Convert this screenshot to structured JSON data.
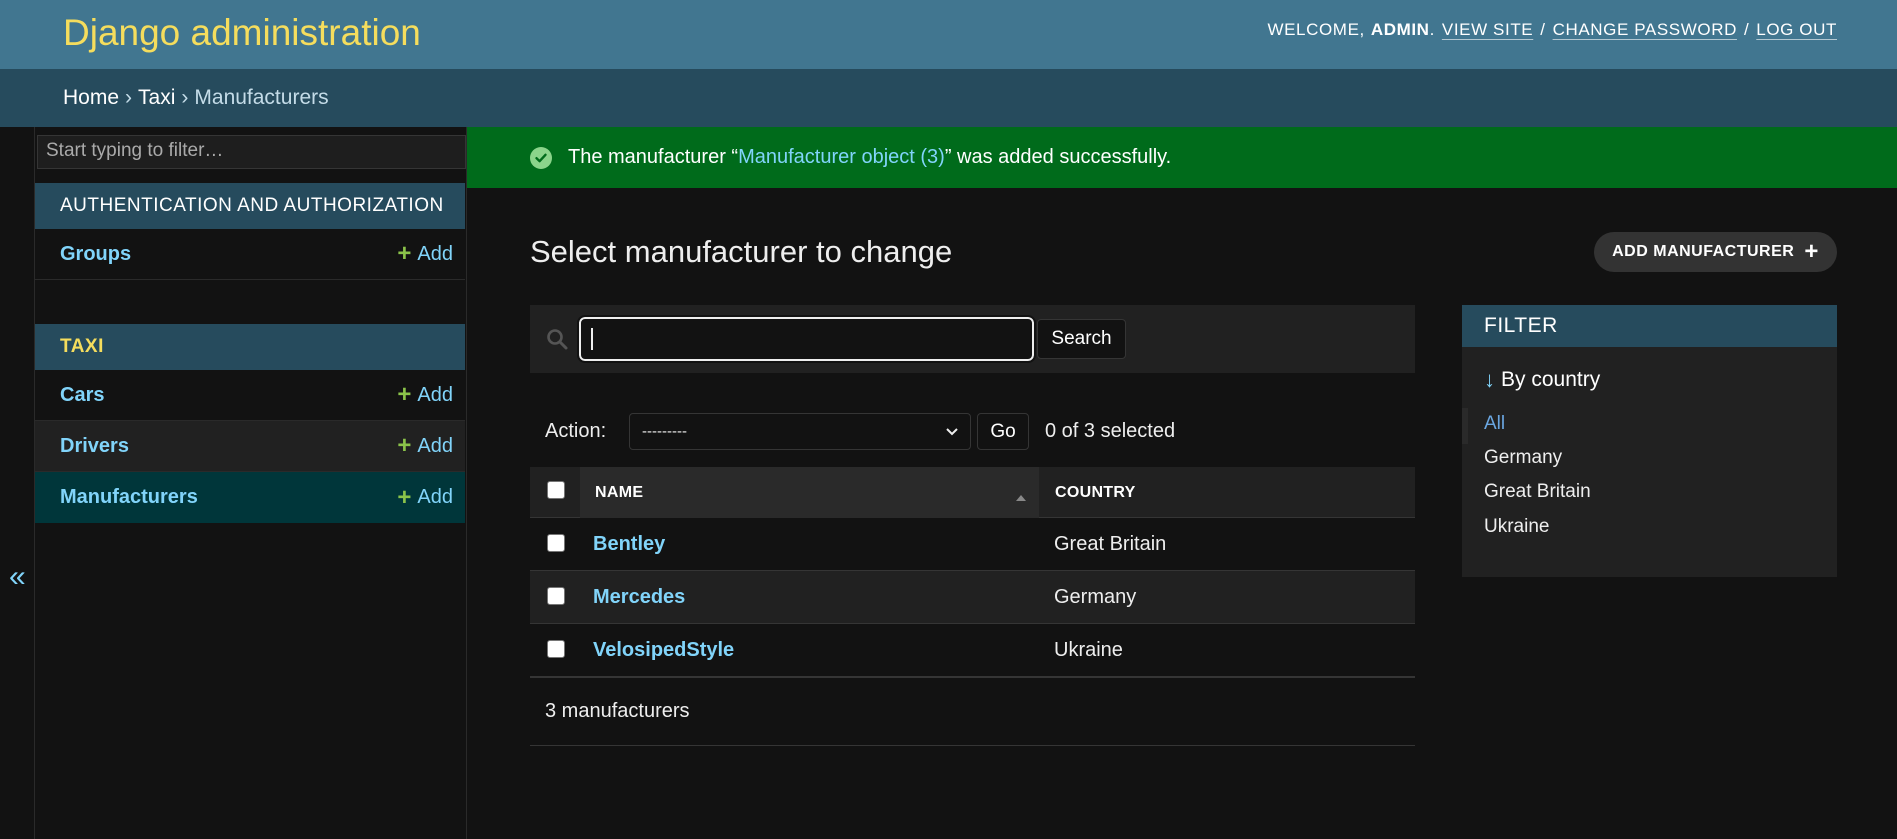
{
  "header": {
    "branding": "Django administration",
    "welcome": "WELCOME,",
    "username": "ADMIN",
    "view_site": "VIEW SITE",
    "change_password": "CHANGE PASSWORD",
    "log_out": "LOG OUT"
  },
  "breadcrumbs": [
    "Home",
    "Taxi",
    "Manufacturers"
  ],
  "sidebar": {
    "filter_placeholder": "Start typing to filter…",
    "collapse_label": "«",
    "modules": [
      {
        "caption": "AUTHENTICATION AND AUTHORIZATION",
        "models": [
          {
            "name": "Groups",
            "add": "Add"
          }
        ]
      },
      {
        "caption": "TAXI",
        "models": [
          {
            "name": "Cars",
            "add": "Add"
          },
          {
            "name": "Drivers",
            "add": "Add"
          },
          {
            "name": "Manufacturers",
            "add": "Add"
          }
        ]
      }
    ]
  },
  "message": {
    "prefix": "The manufacturer “",
    "link": "Manufacturer object (3)",
    "suffix": "” was added successfully."
  },
  "content": {
    "title": "Select manufacturer to change",
    "add_button": "ADD MANUFACTURER",
    "search_button": "Search",
    "action_label": "Action:",
    "action_selected": "---------",
    "go_button": "Go",
    "action_counter": "0 of 3 selected",
    "columns": [
      "NAME",
      "COUNTRY"
    ],
    "rows": [
      {
        "name": "Bentley",
        "country": "Great Britain"
      },
      {
        "name": "Mercedes",
        "country": "Germany"
      },
      {
        "name": "VelosipedStyle",
        "country": "Ukraine"
      }
    ],
    "paginator": "3 manufacturers"
  },
  "filter": {
    "header": "FILTER",
    "title": "By country",
    "options": [
      "All",
      "Germany",
      "Great Britain",
      "Ukraine"
    ],
    "selected": "All"
  },
  "colors": {
    "header_bg": "#417690",
    "breadcrumbs_bg": "#264b5d",
    "branding": "#f5dd5d",
    "link": "#81d4fa",
    "success_bg": "#006b1b",
    "add_plus": "#8bc34a"
  }
}
